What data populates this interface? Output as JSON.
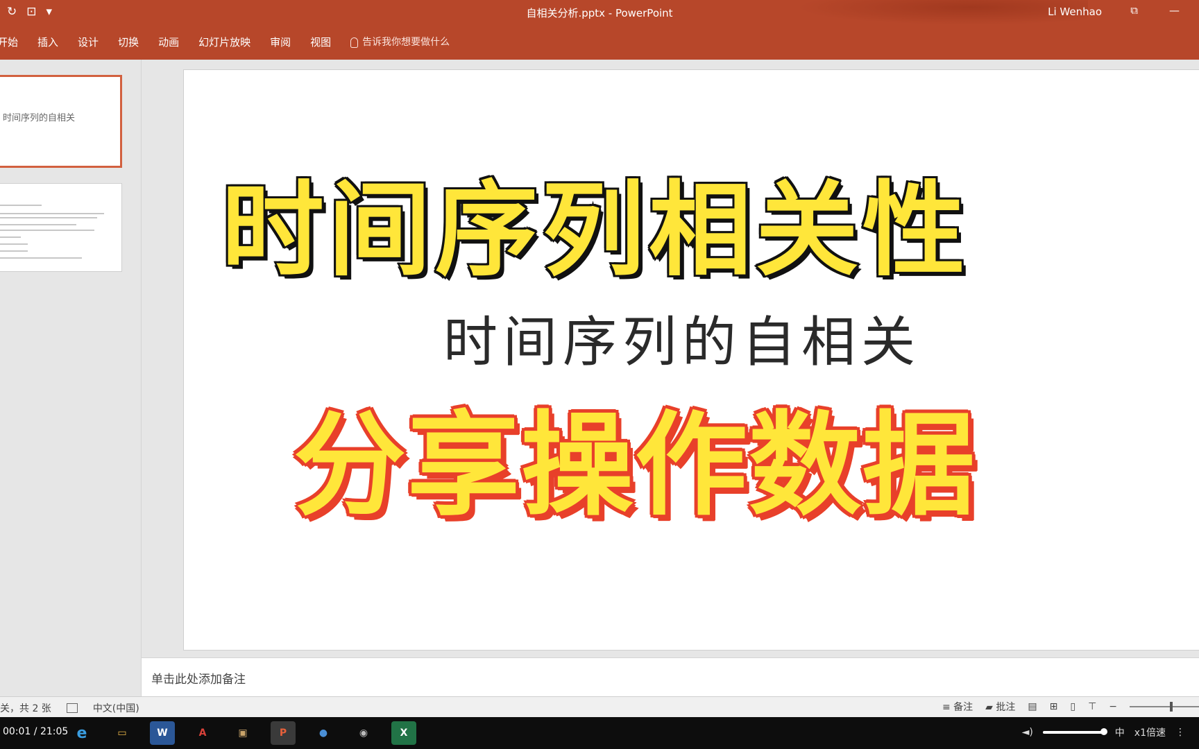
{
  "window": {
    "title": "自相关分析.pptx  -  PowerPoint",
    "user": "Li Wenhao",
    "accent_color": "#b7472a"
  },
  "quick_access": {
    "redo_icon": "redo-icon",
    "present_icon": "present-from-start-icon",
    "customize": "▾"
  },
  "ribbon": {
    "tabs": [
      "开始",
      "插入",
      "设计",
      "切换",
      "动画",
      "幻灯片放映",
      "审阅",
      "视图"
    ],
    "tell_me": "告诉我你想要做什么"
  },
  "thumbnails": {
    "slide1_text": "时间序列的自相关"
  },
  "slide": {
    "headline": "时间序列相关性",
    "subtitle": "时间序列的自相关",
    "banner": "分享操作数据"
  },
  "notes": {
    "placeholder": "单击此处添加备注"
  },
  "statusbar": {
    "slide_count": "关，共 2 张",
    "language": "中文(中国)",
    "notes_label": "备注",
    "comments_label": "批注"
  },
  "taskbar": {
    "time": "00:01 / 21:05",
    "apps": [
      {
        "name": "ie-icon",
        "label": "e"
      },
      {
        "name": "file-explorer-icon",
        "label": "▭"
      },
      {
        "name": "word-icon",
        "label": "W"
      },
      {
        "name": "pdf-icon",
        "label": "A"
      },
      {
        "name": "photos-icon",
        "label": "▣"
      },
      {
        "name": "powerpoint-icon",
        "label": "P"
      },
      {
        "name": "globe-icon",
        "label": "●"
      },
      {
        "name": "avatar-app-icon",
        "label": "◉"
      },
      {
        "name": "excel-icon",
        "label": "X"
      }
    ],
    "ime": "中",
    "speed": "x1倍速"
  }
}
